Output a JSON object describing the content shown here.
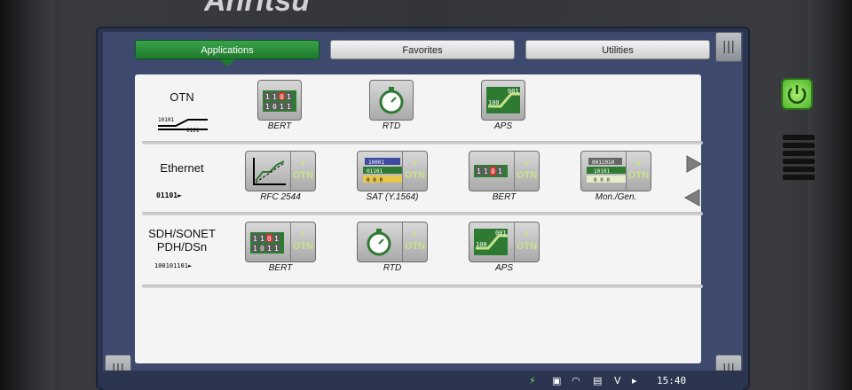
{
  "brand": "Anritsu",
  "tabs": [
    {
      "label": "Applications",
      "active": true
    },
    {
      "label": "Favorites",
      "active": false
    },
    {
      "label": "Utilities",
      "active": false
    }
  ],
  "rows": [
    {
      "category": "OTN",
      "category_icon_text": "1010 0101",
      "apps": [
        {
          "label": "BERT",
          "has_otn": false
        },
        {
          "label": "RTD",
          "has_otn": false
        },
        {
          "label": "APS",
          "has_otn": false
        }
      ]
    },
    {
      "category": "Ethernet",
      "category_icon_text": "01101",
      "apps": [
        {
          "label": "RFC 2544",
          "has_otn": true
        },
        {
          "label": "SAT (Y.1564)",
          "has_otn": true
        },
        {
          "label": "BERT",
          "has_otn": true
        },
        {
          "label": "Mon./Gen.",
          "has_otn": true
        }
      ]
    },
    {
      "category_line1": "SDH/SONET",
      "category_line2": "PDH/DSn",
      "category_icon_text": "100101101",
      "apps": [
        {
          "label": "BERT",
          "has_otn": true
        },
        {
          "label": "RTD",
          "has_otn": true
        },
        {
          "label": "APS",
          "has_otn": true
        }
      ]
    }
  ],
  "otn_badge": {
    "plus": "+",
    "text": "OTN"
  },
  "corner_glyph": "|||",
  "statusbar": {
    "time": "15:40",
    "icons": [
      "plug-icon",
      "screen-icon",
      "wifi-icon",
      "save-icon",
      "v-icon",
      "terminal-icon"
    ],
    "v_text": "V"
  },
  "colors": {
    "active_tab": "#1e7a2d",
    "screen": "#3d4a6e",
    "power_led": "#4cb32a"
  }
}
